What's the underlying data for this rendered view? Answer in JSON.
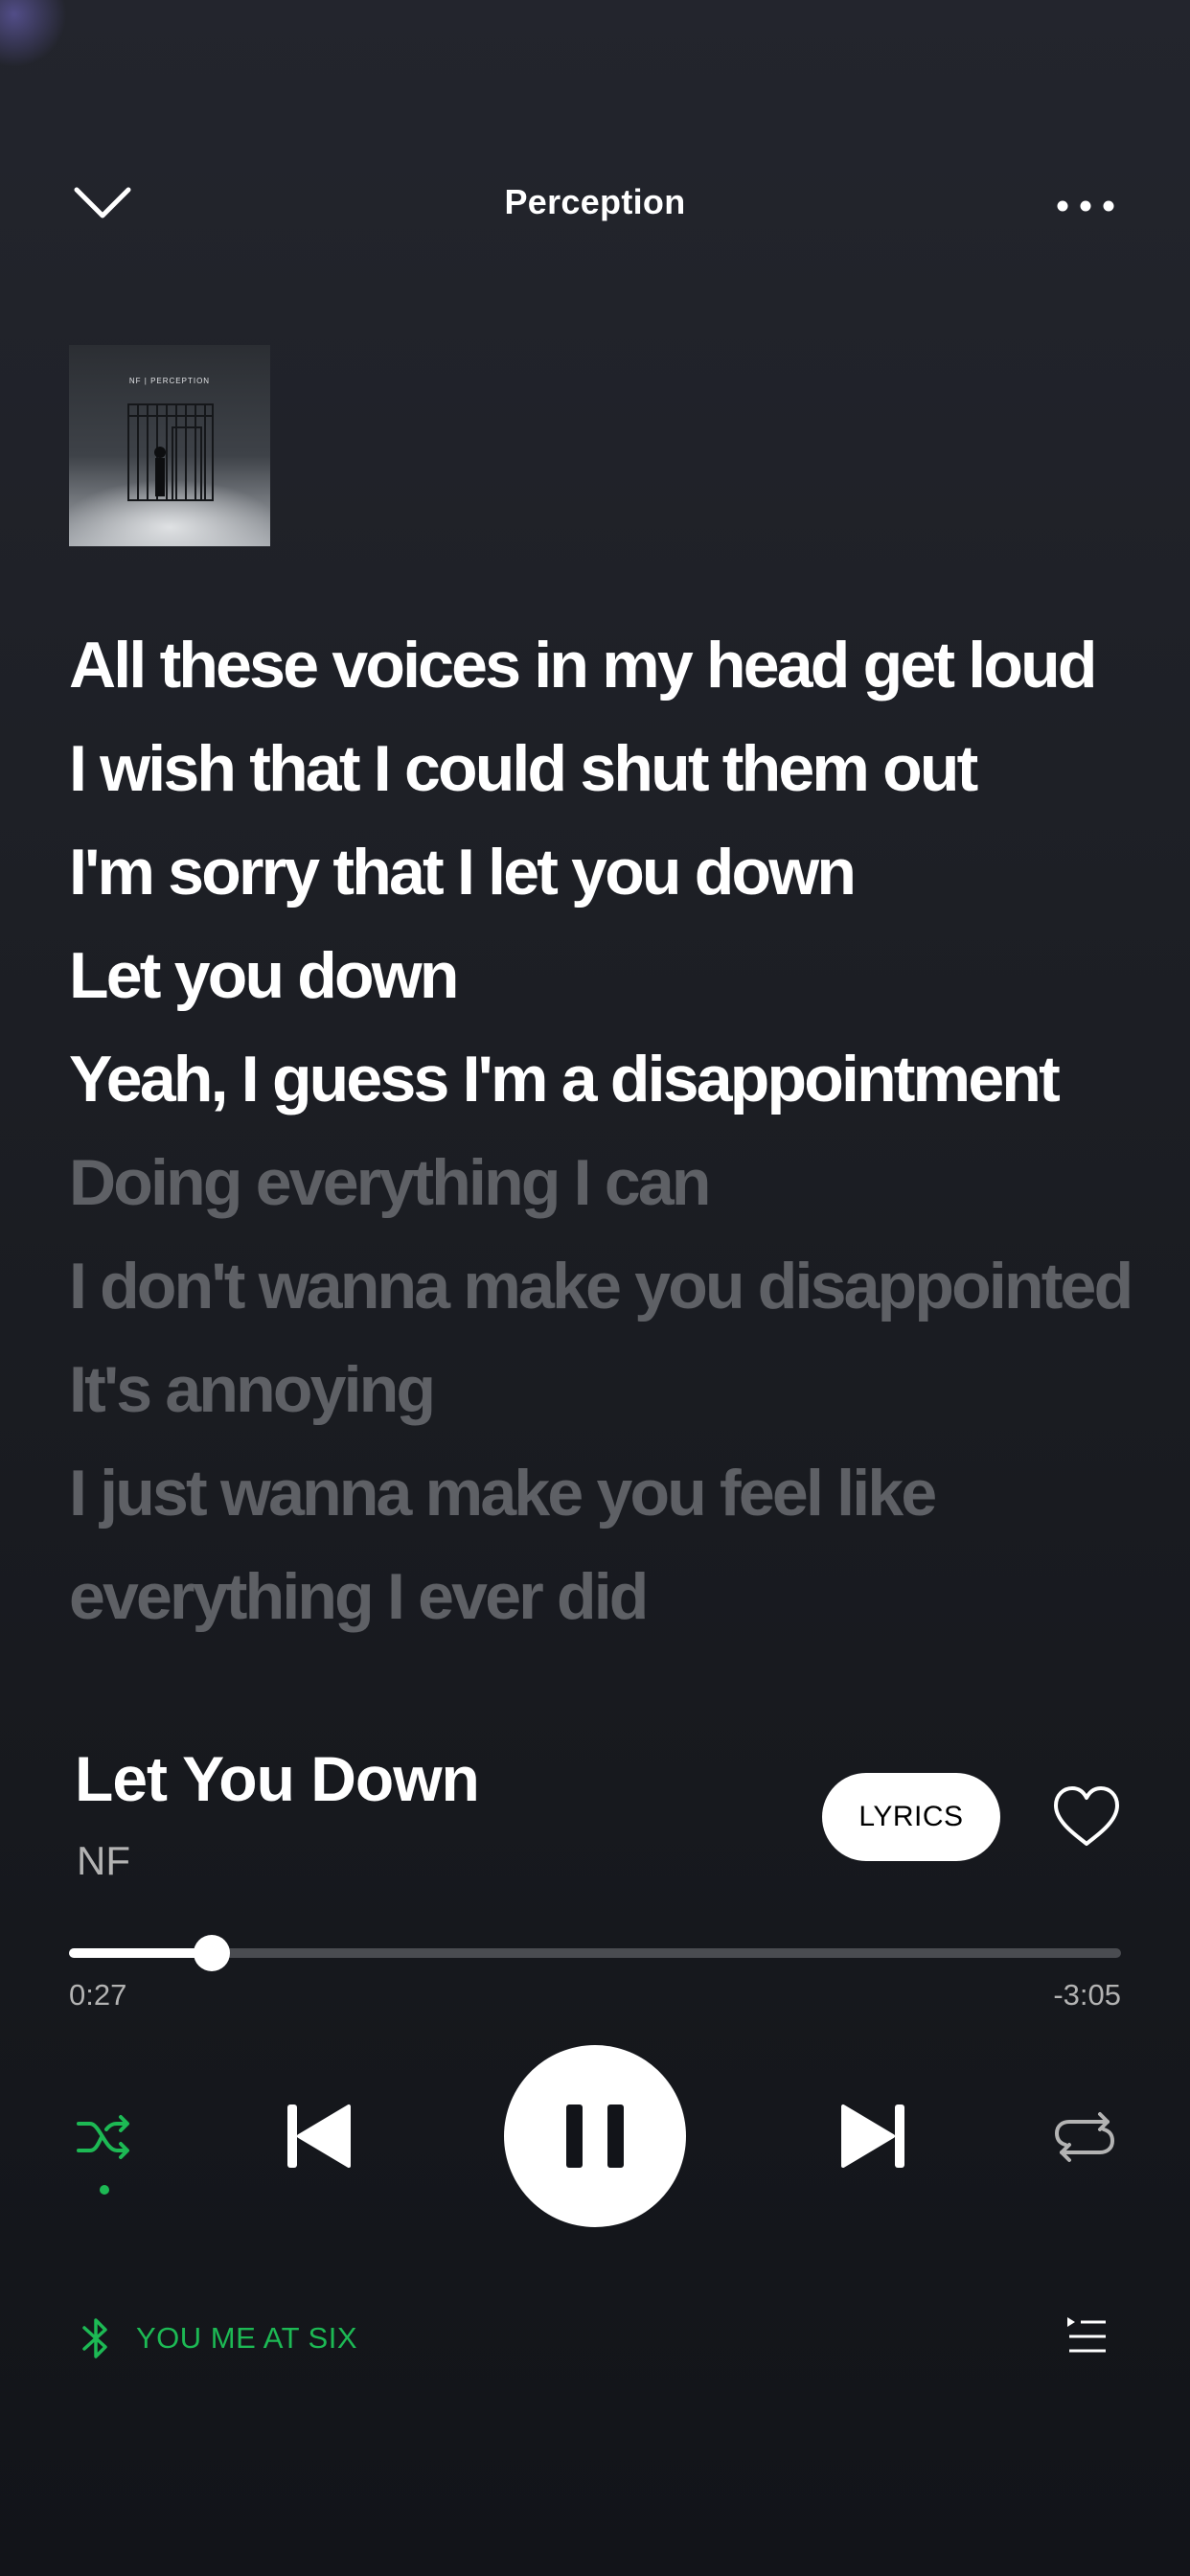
{
  "header": {
    "title": "Perception",
    "collapse_icon": "chevron-down-icon",
    "more_icon": "more-options-icon"
  },
  "album": {
    "art_text": "NF | PERCEPTION"
  },
  "lyrics": {
    "lines": [
      {
        "text": "All these voices in my head get loud",
        "state": "active"
      },
      {
        "text": "I wish that I could shut them out",
        "state": "active"
      },
      {
        "text": "I'm sorry that I let you down",
        "state": "active"
      },
      {
        "text": "Let you down",
        "state": "active"
      },
      {
        "text": "Yeah, I guess I'm a disappointment",
        "state": "active"
      },
      {
        "text": "Doing everything I can",
        "state": "upcoming"
      },
      {
        "text": "I don't wanna make you disappointed",
        "state": "upcoming"
      },
      {
        "text": "It's annoying",
        "state": "upcoming"
      },
      {
        "text": "I just wanna make you feel like",
        "state": "upcoming"
      },
      {
        "text": "everything I ever did",
        "state": "upcoming"
      }
    ]
  },
  "track": {
    "title": "Let You Down",
    "artist": "NF",
    "lyrics_button_label": "LYRICS",
    "like_icon": "heart-icon"
  },
  "progress": {
    "elapsed": "0:27",
    "remaining": "-3:05",
    "fraction": 0.136
  },
  "controls": {
    "shuffle_icon": "shuffle-icon",
    "shuffle_active": true,
    "previous_icon": "skip-previous-icon",
    "play_pause_icon": "pause-icon",
    "next_icon": "skip-next-icon",
    "repeat_icon": "repeat-icon"
  },
  "device": {
    "icon": "bluetooth-icon",
    "name": "YOU ME AT SIX",
    "queue_icon": "queue-icon"
  },
  "colors": {
    "accent_green": "#1db954",
    "background": "#1d1f25",
    "lyric_active": "#ffffff",
    "lyric_upcoming": "#5e6065",
    "secondary_text": "#b3b3b3"
  }
}
